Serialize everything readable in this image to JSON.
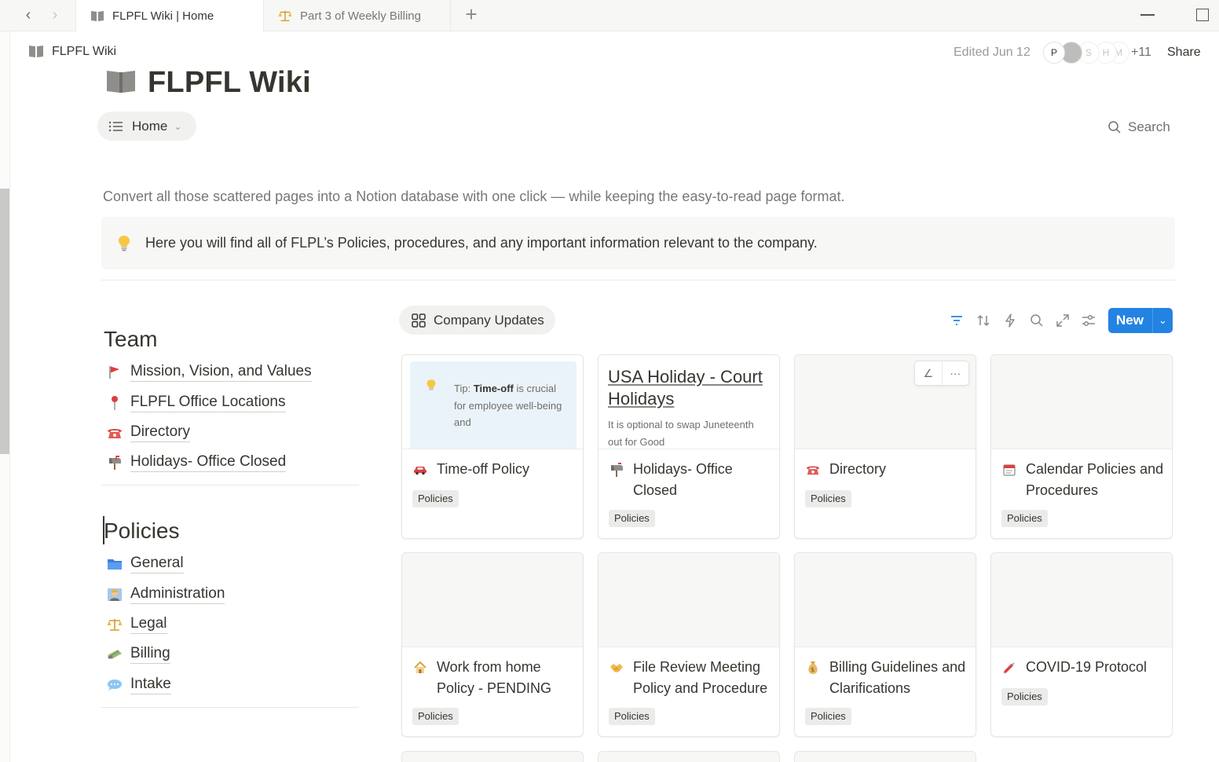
{
  "window": {
    "tabs": [
      {
        "label": "FLPFL Wiki | Home",
        "icon": "book-icon",
        "active": true
      },
      {
        "label": "Part 3 of Weekly Billing",
        "icon": "scales-icon",
        "active": false
      }
    ]
  },
  "topbar": {
    "breadcrumb": "FLPFL Wiki",
    "edited": "Edited Jun 12",
    "avatars": [
      "P",
      "",
      "S",
      "H",
      "M"
    ],
    "more_count": "+11",
    "share_label": "Share"
  },
  "page": {
    "title": "FLPFL Wiki",
    "view_label": "Home",
    "search_label": "Search",
    "description": "Convert all those scattered pages into a Notion database with one click — while keeping the easy-to-read page format.",
    "callout": "Here you will find all of FLPL’s Policies, procedures, and any important information relevant to the company."
  },
  "team": {
    "heading": "Team",
    "items": [
      {
        "label": "Mission, Vision, and Values",
        "icon": "red-flag-icon"
      },
      {
        "label": "FLPFL Office Locations",
        "icon": "pin-icon"
      },
      {
        "label": "Directory",
        "icon": "telephone-icon"
      },
      {
        "label": "Holidays- Office Closed",
        "icon": "mailbox-icon"
      }
    ]
  },
  "policies": {
    "heading": "Policies",
    "items": [
      {
        "label": "General",
        "icon": "folder-icon"
      },
      {
        "label": "Administration",
        "icon": "office-worker-icon"
      },
      {
        "label": "Legal",
        "icon": "scales-icon"
      },
      {
        "label": "Billing",
        "icon": "money-icon"
      },
      {
        "label": "Intake",
        "icon": "speech-bubble-icon"
      }
    ]
  },
  "gallery": {
    "view_label": "Company Updates",
    "new_label": "New",
    "cards": [
      {
        "title": "Time-off Policy",
        "tag": "Policies",
        "icon": "car-icon",
        "tip_prefix": "Tip: ",
        "tip_bold": "Time-off",
        "tip_rest": " is crucial for employee well-being and"
      },
      {
        "title": "Holidays- Office Closed",
        "tag": "Policies",
        "icon": "mailbox-icon",
        "cover_title": "USA Holiday - Court Holidays",
        "cover_text": "It is optional to swap Juneteenth out for Good"
      },
      {
        "title": "Directory",
        "tag": "Policies",
        "icon": "telephone-icon"
      },
      {
        "title": "Calendar Policies and Procedures",
        "tag": "Policies",
        "icon": "calendar-icon"
      },
      {
        "title": "Work from home Policy - PENDING",
        "tag": "Policies",
        "icon": "house-icon"
      },
      {
        "title": "File Review Meeting Policy and Procedure",
        "tag": "Policies",
        "icon": "handshake-icon"
      },
      {
        "title": "Billing Guidelines and Clarifications",
        "tag": "Policies",
        "icon": "money-bag-icon"
      },
      {
        "title": "COVID-19 Protocol",
        "tag": "Policies",
        "icon": "syringe-icon"
      }
    ]
  },
  "colors": {
    "accent": "#2383e2",
    "text": "#37352f",
    "muted": "#787774",
    "tag_bg": "#ebebea"
  }
}
